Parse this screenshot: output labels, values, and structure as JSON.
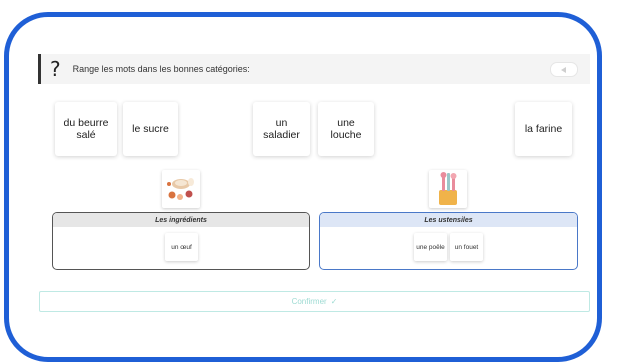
{
  "question": {
    "mark": "?",
    "text": "Range les mots dans les bonnes catégories:",
    "audio_icon": "speaker-play-icon"
  },
  "words": [
    {
      "label": "du beurre salé"
    },
    {
      "label": "le sucre"
    },
    {
      "label": "un saladier"
    },
    {
      "label": "une louche"
    },
    {
      "label": "la farine"
    }
  ],
  "categories": [
    {
      "title": "Les ingrédients",
      "image": "ingredients-icon",
      "items": [
        "un œuf"
      ],
      "border": "#555555",
      "header_bg": "#e6e6e6"
    },
    {
      "title": "Les ustensiles",
      "image": "utensils-icon",
      "items": [
        "une poêle",
        "un fouet"
      ],
      "border": "#4a78c8",
      "header_bg": "#dde6f6"
    }
  ],
  "confirm": {
    "label": "Confirmer",
    "icon": "check-icon"
  },
  "colors": {
    "frame": "#1f5fd6",
    "confirm_text": "#9edbd3",
    "confirm_border": "#bfe9e4"
  }
}
